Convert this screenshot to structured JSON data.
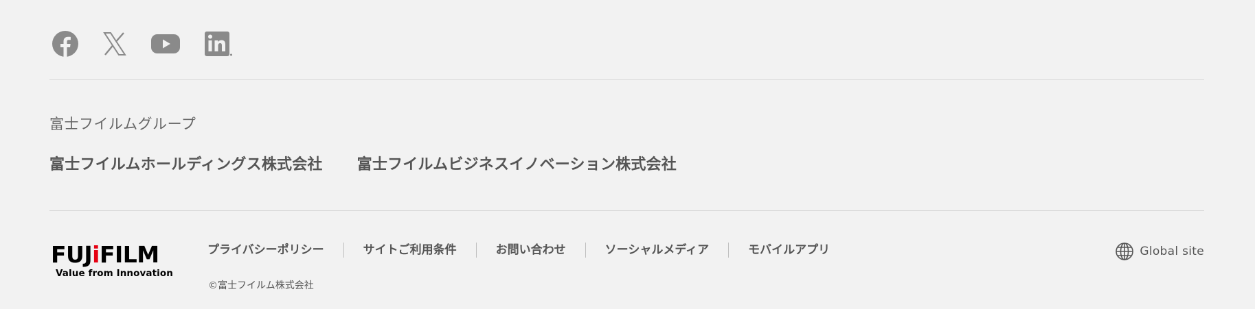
{
  "social": {
    "items": [
      {
        "icon": "facebook-icon"
      },
      {
        "icon": "x-icon"
      },
      {
        "icon": "youtube-icon"
      },
      {
        "icon": "linkedin-icon"
      }
    ],
    "icon_color": "#8a8a8a"
  },
  "group": {
    "heading": "富士フイルムグループ",
    "links": [
      "富士フイルムホールディングス株式会社",
      "富士フイルムビジネスイノベーション株式会社"
    ]
  },
  "logo": {
    "word_part1": "FUJ",
    "word_accent": "i",
    "word_part2": "FILM",
    "tagline": "Value from Innovation",
    "accent_color": "#e60012"
  },
  "footer_nav": [
    "プライバシーポリシー",
    "サイトご利用条件",
    "お問い合わせ",
    "ソーシャルメディア",
    "モバイルアプリ"
  ],
  "copyright": "©富士フイルム株式会社",
  "global": {
    "label": "Global site",
    "icon": "globe-icon"
  }
}
